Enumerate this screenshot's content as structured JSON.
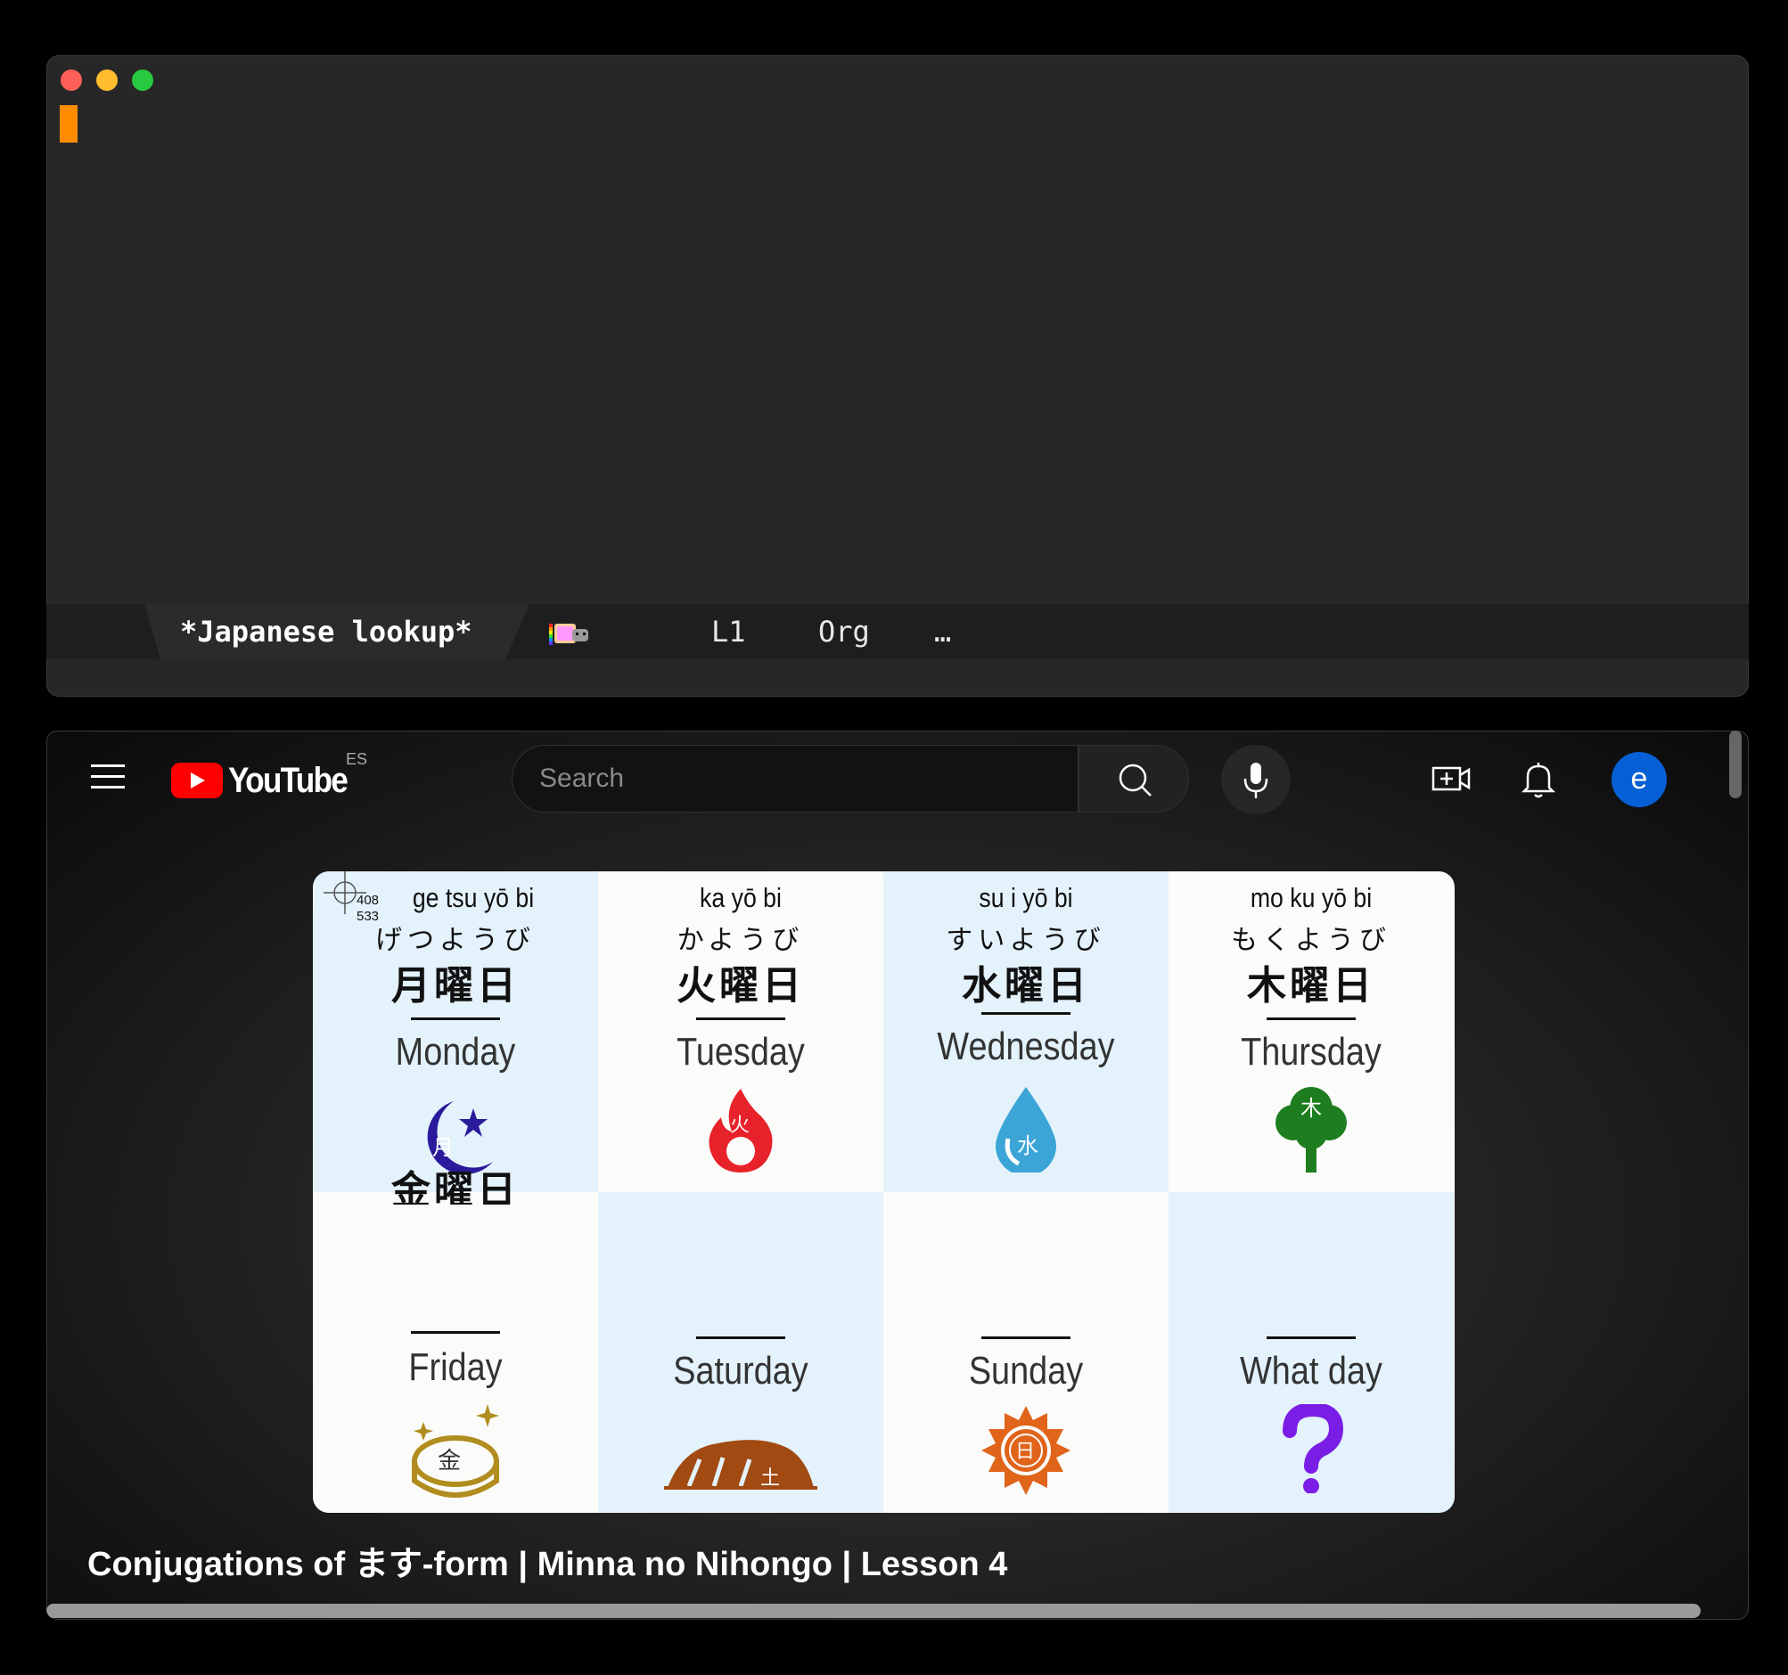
{
  "emacs": {
    "buffer_name": "*Japanese lookup*",
    "line": "L1",
    "mode": "Org",
    "ellipsis": "…"
  },
  "youtube": {
    "logo_text": "YouTube",
    "region": "ES",
    "search_placeholder": "Search",
    "avatar_letter": "e",
    "video_title": "Conjugations of ます-form | Minna no Nihongo | Lesson 4",
    "overlay_coords": [
      "408",
      "533"
    ],
    "progress": 1.0,
    "days": [
      {
        "romaji": "ge tsu yō bi",
        "kana": "げつようび",
        "kanji": "月曜日",
        "english": "Monday",
        "icon": "moon-star-icon"
      },
      {
        "romaji": "ka yō bi",
        "kana": "かようび",
        "kanji": "火曜日",
        "english": "Tuesday",
        "icon": "fire-icon"
      },
      {
        "romaji": "su i yō bi",
        "kana": "すいようび",
        "kanji": "水曜日",
        "english": "Wednesday",
        "icon": "water-drop-icon"
      },
      {
        "romaji": "mo ku yō bi",
        "kana": "もくようび",
        "kanji": "木曜日",
        "english": "Thursday",
        "icon": "tree-icon"
      },
      {
        "kanji": "金曜日",
        "english": "Friday",
        "icon": "gold-coin-icon"
      },
      {
        "english": "Saturday",
        "icon": "rock-earth-icon"
      },
      {
        "english": "Sunday",
        "icon": "sun-icon"
      },
      {
        "english": "What day",
        "icon": "question-mark-icon"
      }
    ],
    "icon_glyphs": {
      "moon": "月",
      "fire": "火",
      "water": "水",
      "tree": "木",
      "gold": "金",
      "earth": "土",
      "sun": "日"
    },
    "colors": {
      "brand_red": "#ff0000",
      "avatar_blue": "#065fd4",
      "cell_blue": "#e3f2fb"
    }
  }
}
